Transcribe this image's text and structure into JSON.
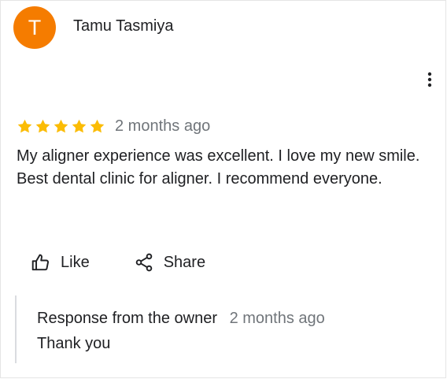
{
  "review": {
    "author": {
      "initial": "T",
      "name": "Tamu Tasmiya",
      "avatar_color": "#f57c00"
    },
    "menu_icon": "more-vert-icon",
    "rating": 5,
    "rating_max": 5,
    "star_color": "#fbbc04",
    "date": "2 months ago",
    "text": "My aligner experience was excellent. I love my new smile. Best dental clinic for aligner. I recommend everyone."
  },
  "actions": {
    "like": {
      "label": "Like",
      "icon": "thumbs-up-icon"
    },
    "share": {
      "label": "Share",
      "icon": "share-icon"
    }
  },
  "owner_response": {
    "title": "Response from the owner",
    "date": "2 months ago",
    "text": "Thank you"
  }
}
